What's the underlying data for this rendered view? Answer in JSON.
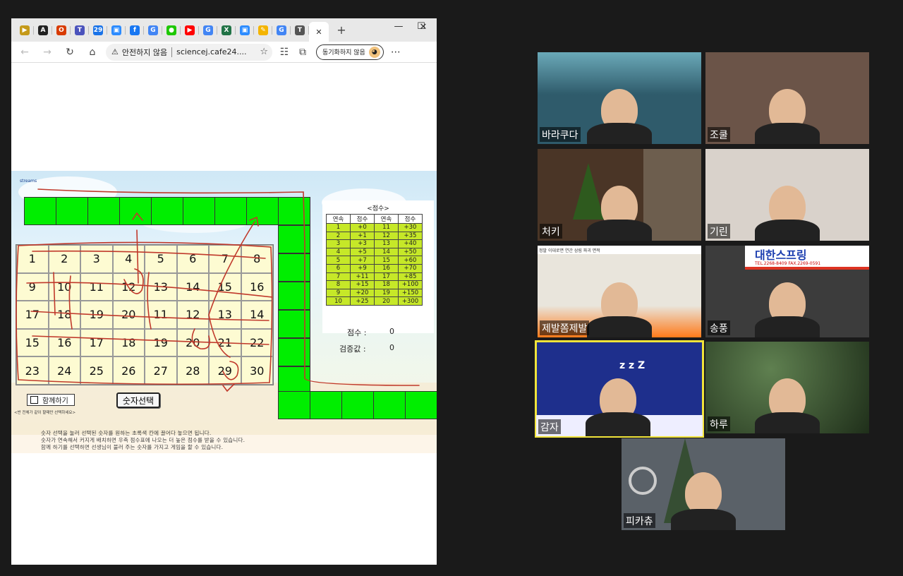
{
  "browser": {
    "tabs": [
      {
        "icon": "tab-favicon",
        "glyph": "▶",
        "color": "#c59a1a"
      },
      {
        "icon": "tab-font",
        "glyph": "A",
        "color": "#222222"
      },
      {
        "icon": "tab-office",
        "glyph": "O",
        "color": "#d83b01"
      },
      {
        "icon": "tab-teams",
        "glyph": "T",
        "color": "#4b53bc"
      },
      {
        "icon": "tab-calendar",
        "glyph": "29",
        "color": "#1a73e8"
      },
      {
        "icon": "tab-zoom",
        "glyph": "▣",
        "color": "#2d8cff"
      },
      {
        "icon": "tab-facebook",
        "glyph": "f",
        "color": "#1877f2"
      },
      {
        "icon": "tab-google",
        "glyph": "G",
        "color": "#4285f4"
      },
      {
        "icon": "tab-chat",
        "glyph": "●",
        "color": "#1ec800"
      },
      {
        "icon": "tab-youtube",
        "glyph": "▶",
        "color": "#ff0000"
      },
      {
        "icon": "tab-google",
        "glyph": "G",
        "color": "#4285f4"
      },
      {
        "icon": "tab-excel",
        "glyph": "X",
        "color": "#217346"
      },
      {
        "icon": "tab-zoom",
        "glyph": "▣",
        "color": "#2d8cff"
      },
      {
        "icon": "tab-note",
        "glyph": "✎",
        "color": "#f4b400"
      },
      {
        "icon": "tab-google",
        "glyph": "G",
        "color": "#4285f4"
      },
      {
        "icon": "tab-t",
        "glyph": "T",
        "color": "#555555"
      }
    ],
    "active_tab_close": "✕",
    "new_tab": "+",
    "minimize": "—",
    "maximize": "☐",
    "close": "✕",
    "back": "←",
    "forward": "→",
    "refresh": "↻",
    "home": "⌂",
    "security_warning": "안전하지 않음",
    "url": "sciencej.cafe24....",
    "sync_button": "동기화하지 않음",
    "more": "⋯"
  },
  "game": {
    "streams_label": "streams",
    "score_title": "<점수>",
    "score_headers": [
      "연속",
      "점수",
      "연속",
      "점수"
    ],
    "score_rows": [
      [
        "1",
        "+0",
        "11",
        "+30"
      ],
      [
        "2",
        "+1",
        "12",
        "+35"
      ],
      [
        "3",
        "+3",
        "13",
        "+40"
      ],
      [
        "4",
        "+5",
        "14",
        "+50"
      ],
      [
        "5",
        "+7",
        "15",
        "+60"
      ],
      [
        "6",
        "+9",
        "16",
        "+70"
      ],
      [
        "7",
        "+11",
        "17",
        "+85"
      ],
      [
        "8",
        "+15",
        "18",
        "+100"
      ],
      [
        "9",
        "+20",
        "19",
        "+150"
      ],
      [
        "10",
        "+25",
        "20",
        "+300"
      ]
    ],
    "score_label": "점수 :",
    "score_value": "0",
    "verify_label": "검증값 :",
    "verify_value": "0",
    "grid_numbers": [
      "1",
      "2",
      "3",
      "4",
      "5",
      "6",
      "7",
      "8",
      "9",
      "10",
      "11",
      "12",
      "13",
      "14",
      "15",
      "16",
      "17",
      "18",
      "19",
      "20",
      "11",
      "12",
      "13",
      "14",
      "15",
      "16",
      "17",
      "18",
      "19",
      "20",
      "21",
      "22",
      "23",
      "24",
      "25",
      "26",
      "27",
      "28",
      "29",
      "30"
    ],
    "together_label": "함께하기",
    "together_note": "<반 전체가 같이 할때만 선택하세요>",
    "pick_button": "숫자선택",
    "instructions": [
      "숫자 선택을 눌러 선택된 숫자를 원하는 초록색 칸에 끌어다 놓으면 됩니다.",
      "숫자가 연속해서 커지게 배치하면 우측 점수표에 나오는 더 높은 점수를 받을 수 있습니다.",
      "함께 하기를 선택하면 선생님이 불러 주는 숫자를 가지고 게임을 할 수 있습니다."
    ]
  },
  "participants": [
    {
      "name": "바라쿠다",
      "bg": "#2f5b6b"
    },
    {
      "name": "조쿨",
      "bg": "#6b5448"
    },
    {
      "name": "처키",
      "bg": "#4a3526"
    },
    {
      "name": "기린",
      "bg": "#d9d2cb"
    },
    {
      "name": "제발쫌제발",
      "bg": "#e9e5dc"
    },
    {
      "name": "송풍",
      "bg": "#3c3c3c"
    },
    {
      "name": "감자",
      "bg": "#1e2f8c"
    },
    {
      "name": "하루",
      "bg": "#314a2b"
    },
    {
      "name": "피카츄",
      "bg": "#5a6168"
    }
  ],
  "tile_text": {
    "sign_main": "대한스프링",
    "sign_sub": "TEL.2268-8409  FAX.2269-0591",
    "zzz": "z z Z",
    "slide_header": "정말 이대로면 연간 삼림 파괴 면적"
  },
  "colors": {
    "green_cell": "#00ee00",
    "score_cell": "#c6e828",
    "scribble": "#c0392b",
    "active_speaker": "#f0e33a"
  }
}
